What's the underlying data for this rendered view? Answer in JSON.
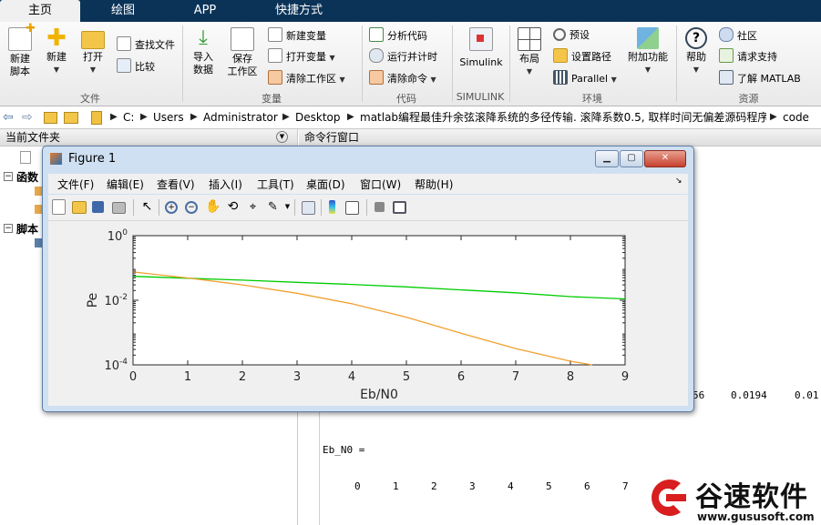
{
  "tabs": [
    "主页",
    "绘图",
    "APP",
    "快捷方式"
  ],
  "ribbon": {
    "new_script": "新建\n脚本",
    "new": "新建",
    "open": "打开",
    "find_files": "查找文件",
    "compare": "比较",
    "import_data": "导入\n数据",
    "save_workspace": "保存\n工作区",
    "new_variable": "新建变量",
    "open_variable": "打开变量",
    "clear_workspace": "清除工作区",
    "analyze_code": "分析代码",
    "run_and_time": "运行并计时",
    "clear_commands": "清除命令",
    "simulink": "Simulink",
    "layout": "布局",
    "preferences": "预设",
    "set_path": "设置路径",
    "parallel": "Parallel",
    "addons": "附加功能",
    "help": "帮助",
    "community": "社区",
    "request_support": "请求支持",
    "learn_matlab": "了解 MATLAB",
    "groups": {
      "file": "文件",
      "variable": "变量",
      "code": "代码",
      "simulink": "SIMULINK",
      "environment": "环境",
      "resources": "资源"
    }
  },
  "address": {
    "crumbs": [
      "C:",
      "Users",
      "Administrator",
      "Desktop",
      "matlab编程最佳升余弦滚降系统的多径传输. 滚降系数0.5, 取样时间无偏差源码程序",
      "code"
    ]
  },
  "current_folder": {
    "title": "当前文件夹",
    "sections": [
      "函数",
      "脚本"
    ]
  },
  "command_window": {
    "title": "命令行窗口",
    "row_partial": [
      "56",
      "0.0194",
      "0.01"
    ],
    "var_line": "Eb_N0 =",
    "values": [
      "0",
      "1",
      "2",
      "3",
      "4",
      "5",
      "6",
      "7"
    ]
  },
  "figure": {
    "title": "Figure 1",
    "menu": [
      "文件(F)",
      "编辑(E)",
      "查看(V)",
      "插入(I)",
      "工具(T)",
      "桌面(D)",
      "窗口(W)",
      "帮助(H)"
    ]
  },
  "chart_data": {
    "type": "line",
    "xlabel": "Eb/N0",
    "ylabel": "Pe",
    "xlim": [
      0,
      9
    ],
    "ylim": [
      0.0001,
      1
    ],
    "yscale": "log",
    "xticks": [
      "0",
      "1",
      "2",
      "3",
      "4",
      "5",
      "6",
      "7",
      "8",
      "9"
    ],
    "yticks": [
      {
        "base": "10",
        "exp": "0"
      },
      {
        "base": "10",
        "exp": "-2"
      },
      {
        "base": "10",
        "exp": "-4"
      }
    ],
    "grid": false,
    "series": [
      {
        "color": "#00cc00",
        "x": [
          0,
          1,
          2,
          3,
          4,
          5,
          6,
          7,
          8,
          9
        ],
        "y": [
          0.055,
          0.048,
          0.042,
          0.036,
          0.031,
          0.026,
          0.021,
          0.017,
          0.013,
          0.011
        ]
      },
      {
        "color": "#f0a030",
        "x": [
          0,
          1,
          2,
          3,
          4,
          5,
          6,
          7,
          8,
          8.4
        ],
        "y": [
          0.075,
          0.049,
          0.03,
          0.0165,
          0.0078,
          0.003,
          0.00095,
          0.00032,
          0.00013,
          0.0001
        ]
      }
    ]
  },
  "watermark": {
    "brand": "谷速软件",
    "url": "www.gususoft.com",
    "color": "#d81e1e"
  }
}
